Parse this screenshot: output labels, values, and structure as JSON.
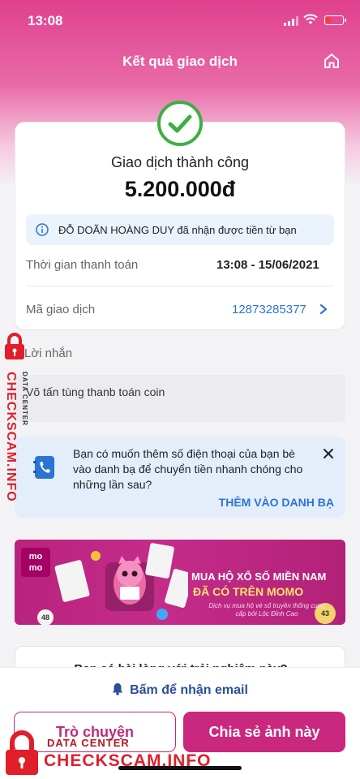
{
  "status_bar": {
    "time": "13:08"
  },
  "header": {
    "title": "Kết quả giao dịch",
    "home_icon": "home-icon"
  },
  "result": {
    "status": "Giao dịch thành công",
    "amount": "5.200.000đ",
    "receiver_note": "ĐỖ DOÃN HOÀNG DUY đã nhận được tiền từ bạn",
    "time_label": "Thời gian thanh toán",
    "time_value": "13:08 - 15/06/2021",
    "txn_label": "Mã giao dịch",
    "txn_value": "12873285377",
    "success_color": "#3cb043"
  },
  "message": {
    "label": "Lời nhắn",
    "text": "Võ tấn tùng thanb toán coin"
  },
  "contact_prompt": {
    "text": "Bạn có muốn thêm số điện thoại của bạn bè vào danh bạ để chuyển tiền nhanh chóng cho những lần sau?",
    "action": "THÊM VÀO DANH BẠ"
  },
  "banner": {
    "logo": "mo mo",
    "headline": "MUA HỘ XỔ SỐ MIỀN NAM",
    "headline2": "ĐÃ CÓ TRÊN MOMO",
    "sub": "Dịch vụ mua hộ vé số truyền thống cung cấp bởi Lộc Đỉnh Cao",
    "ball_numbers": [
      "48",
      "43"
    ]
  },
  "survey": {
    "question": "Bạn có hài lòng với trải nghiệm này?"
  },
  "bottom": {
    "email_link": "Bấm để nhận email",
    "chat_button": "Trò chuyện",
    "share_button": "Chia sẻ ảnh này"
  },
  "watermark": {
    "side_text": "CHECKSCAM.INFO",
    "side_sub": "DATA CENTER",
    "bottom_sub": "DATA CENTER",
    "bottom_text": "CHECKSCAM.INFO",
    "color": "#e01f2a"
  },
  "colors": {
    "brand_pink": "#c9287e",
    "link_blue": "#2a74d6"
  }
}
